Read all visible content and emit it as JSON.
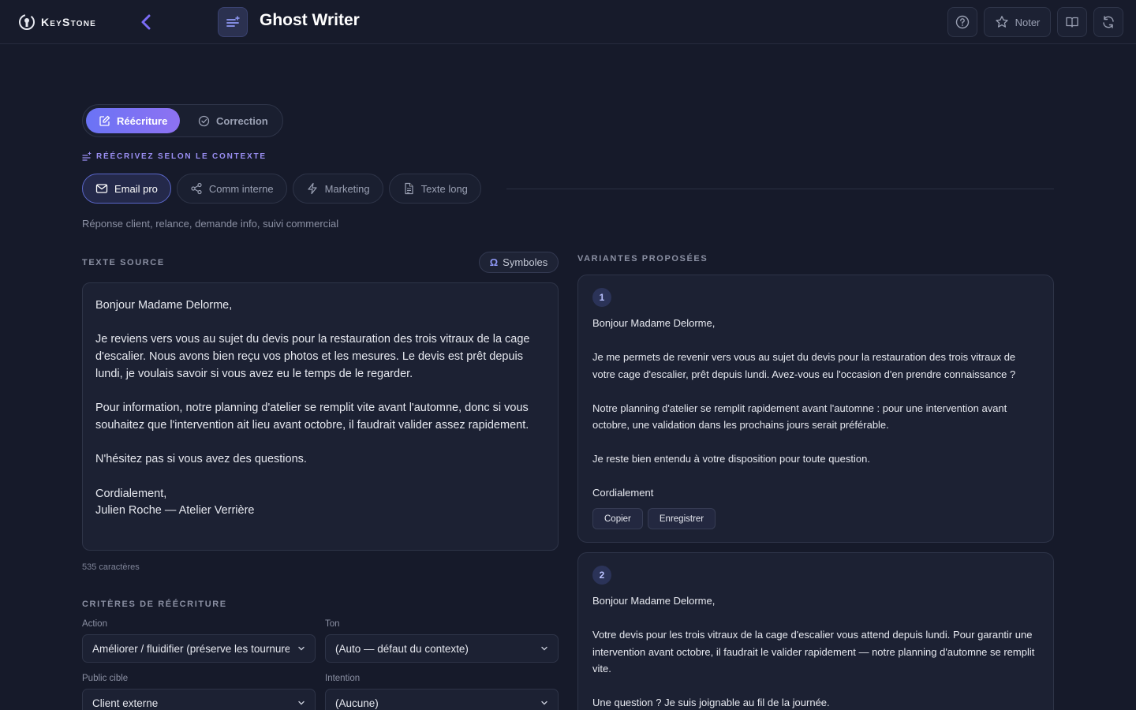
{
  "brand": {
    "name": "KeyStone"
  },
  "header": {
    "title": "Ghost Writer",
    "rate_label": "Noter"
  },
  "modes": [
    {
      "label": "Réécriture",
      "active": true
    },
    {
      "label": "Correction",
      "active": false
    }
  ],
  "context": {
    "kicker": "RÉÉCRIVEZ SELON LE CONTEXTE",
    "chips": [
      {
        "label": "Email pro",
        "icon": "mail-icon",
        "active": true
      },
      {
        "label": "Comm interne",
        "icon": "share-icon",
        "active": false
      },
      {
        "label": "Marketing",
        "icon": "zap-icon",
        "active": false
      },
      {
        "label": "Texte long",
        "icon": "document-icon",
        "active": false
      }
    ],
    "description": "Réponse client, relance, demande info, suivi commercial"
  },
  "source": {
    "label": "TEXTE SOURCE",
    "symbols_label": "Symboles",
    "text": "Bonjour Madame Delorme,\n\nJe reviens vers vous au sujet du devis pour la restauration des trois vitraux de la cage d'escalier. Nous avons bien reçu vos photos et les mesures. Le devis est prêt depuis lundi, je voulais savoir si vous avez eu le temps de le regarder.\n\nPour information, notre planning d'atelier se remplit vite avant l'automne, donc si vous souhaitez que l'intervention ait lieu avant octobre, il faudrait valider assez rapidement.\n\nN'hésitez pas si vous avez des questions.\n\nCordialement,\nJulien Roche — Atelier Verrière",
    "char_count": "535 caractères"
  },
  "criteria": {
    "label": "CRITÈRES DE RÉÉCRITURE",
    "action": {
      "label": "Action",
      "value": "Améliorer / fluidifier (préserve les tournures)"
    },
    "tone": {
      "label": "Ton",
      "value": "(Auto — défaut du contexte)"
    },
    "audience": {
      "label": "Public cible",
      "value": "Client externe"
    },
    "intent": {
      "label": "Intention",
      "value": "(Aucune)"
    }
  },
  "variants": {
    "label": "VARIANTES PROPOSÉES",
    "copy_label": "Copier",
    "save_label": "Enregistrer",
    "items": [
      {
        "num": "1",
        "text": "Bonjour Madame Delorme,\n\nJe me permets de revenir vers vous au sujet du devis pour la restauration des trois vitraux de votre cage d'escalier, prêt depuis lundi. Avez-vous eu l'occasion d'en prendre connaissance ?\n\nNotre planning d'atelier se remplit rapidement avant l'automne : pour une intervention avant octobre, une validation dans les prochains jours serait préférable.\n\nJe reste bien entendu à votre disposition pour toute question.\n\nCordialement"
      },
      {
        "num": "2",
        "text": "Bonjour Madame Delorme,\n\nVotre devis pour les trois vitraux de la cage d'escalier vous attend depuis lundi. Pour garantir une intervention avant octobre, il faudrait le valider rapidement — notre planning d'automne se remplit vite.\n\nUne question ? Je suis joignable au fil de la journée."
      }
    ]
  },
  "colors": {
    "accent": "#6a73f5",
    "accent_secondary": "#8e72f2",
    "background": "#161a2a",
    "surface": "#1c2133"
  }
}
